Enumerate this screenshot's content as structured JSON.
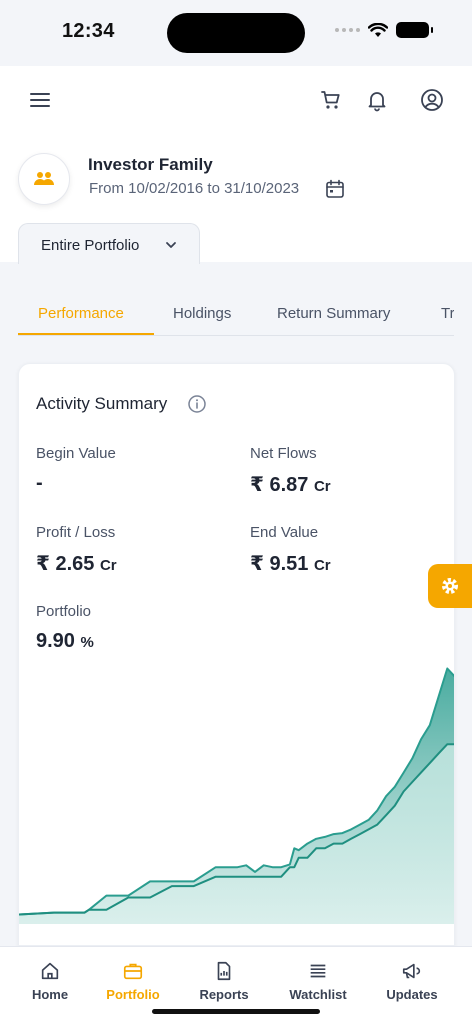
{
  "status_bar": {
    "time": "12:34"
  },
  "header": {
    "family_name": "Investor Family",
    "date_range": "From 10/02/2016 to 31/10/2023",
    "portfolio_selector": "Entire Portfolio",
    "icons": [
      "menu-icon",
      "cart-icon",
      "bell-icon",
      "user-icon",
      "calendar-icon"
    ]
  },
  "tabs": [
    {
      "label": "Performance",
      "active": true
    },
    {
      "label": "Holdings"
    },
    {
      "label": "Return Summary"
    },
    {
      "label": "Tr"
    }
  ],
  "activity_summary": {
    "title": "Activity Summary",
    "begin_value_label": "Begin Value",
    "begin_value": "-",
    "net_flows_label": "Net Flows",
    "net_flows_value": "₹ 6.87",
    "net_flows_unit": "Cr",
    "profit_loss_label": "Profit / Loss",
    "profit_loss_value": "₹ 2.65",
    "profit_loss_unit": "Cr",
    "end_value_label": "End Value",
    "end_value_value": "₹ 9.51",
    "end_value_unit": "Cr",
    "portfolio_label": "Portfolio",
    "portfolio_value": "9.90",
    "portfolio_unit": "%"
  },
  "chart_data": {
    "type": "area",
    "x": [
      0,
      8,
      15,
      16,
      20,
      25,
      30,
      35,
      40,
      45,
      50,
      52,
      54,
      56,
      58,
      60,
      62,
      63,
      64,
      66,
      68,
      70,
      72,
      74,
      76,
      78,
      80,
      82,
      84,
      86,
      88,
      90,
      92,
      94,
      96,
      98,
      100
    ],
    "series": [
      {
        "values": [
          0.1,
          0.12,
          0.12,
          0.15,
          0.3,
          0.3,
          0.45,
          0.45,
          0.45,
          0.6,
          0.6,
          0.62,
          0.55,
          0.62,
          0.6,
          0.6,
          0.63,
          0.8,
          0.78,
          0.85,
          0.9,
          0.92,
          0.95,
          0.96,
          1.0,
          1.05,
          1.1,
          1.2,
          1.35,
          1.45,
          1.6,
          1.75,
          1.95,
          2.1,
          2.4,
          2.7,
          2.6
        ],
        "color": "#2a9d8f"
      },
      {
        "values": [
          0.1,
          0.12,
          0.12,
          0.15,
          0.15,
          0.28,
          0.28,
          0.4,
          0.4,
          0.5,
          0.5,
          0.5,
          0.5,
          0.5,
          0.5,
          0.5,
          0.6,
          0.6,
          0.7,
          0.7,
          0.8,
          0.8,
          0.85,
          0.85,
          0.9,
          0.95,
          1.0,
          1.05,
          1.15,
          1.25,
          1.4,
          1.5,
          1.6,
          1.7,
          1.8,
          1.9,
          1.9
        ],
        "color": "#1f8f80"
      }
    ],
    "ylim": [
      0,
      2.8
    ],
    "grid": false,
    "legend": "none"
  },
  "bottom_nav": [
    {
      "label": "Home",
      "icon": "home-icon"
    },
    {
      "label": "Portfolio",
      "icon": "briefcase-icon",
      "active": true
    },
    {
      "label": "Reports",
      "icon": "report-icon"
    },
    {
      "label": "Watchlist",
      "icon": "list-icon"
    },
    {
      "label": "Updates",
      "icon": "megaphone-icon"
    }
  ],
  "colors": {
    "accent": "#f5a700",
    "chart": "#2a9d8f",
    "text": "#1f2533"
  }
}
